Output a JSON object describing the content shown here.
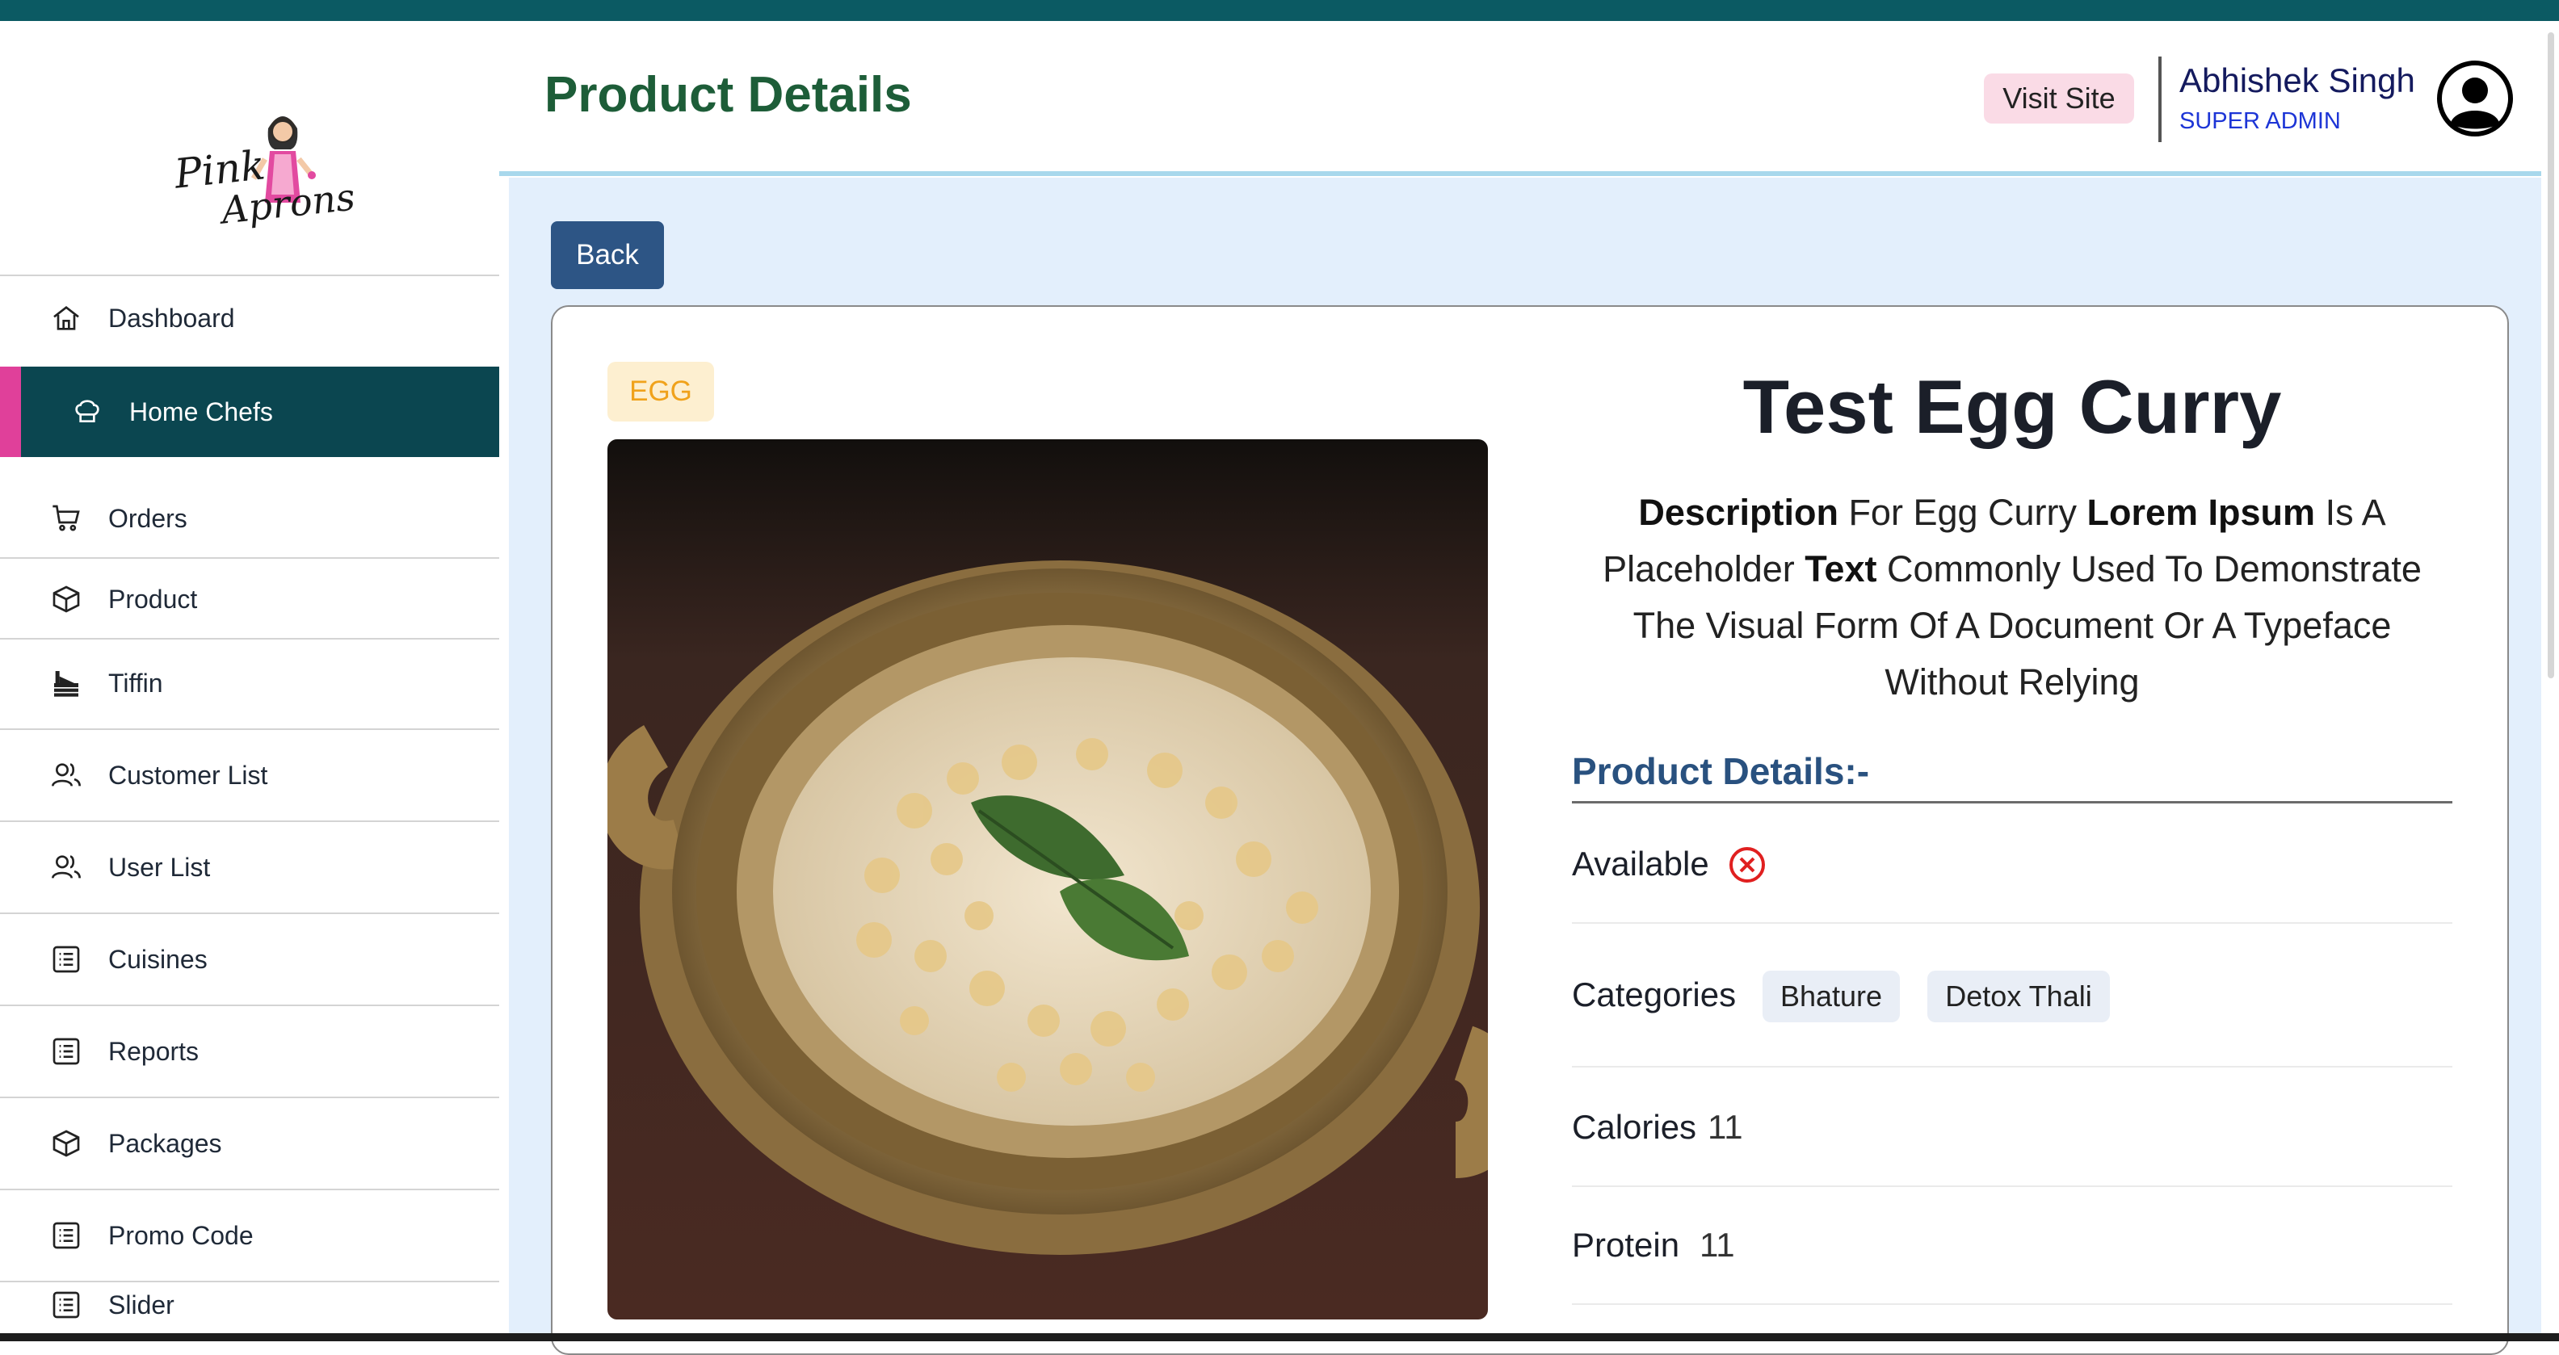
{
  "header": {
    "page_title": "Product Details",
    "visit_site_label": "Visit Site",
    "user_name": "Abhishek Singh",
    "user_role": "SUPER ADMIN"
  },
  "logo": {
    "line1": "Pink",
    "line2": "Aprons"
  },
  "sidebar": {
    "items": [
      {
        "label": "Dashboard",
        "icon": "home-icon"
      },
      {
        "label": "Home Chefs",
        "icon": "chef-hat-icon",
        "active": true
      },
      {
        "label": "Orders",
        "icon": "cart-icon"
      },
      {
        "label": "Product",
        "icon": "box-icon"
      },
      {
        "label": "Tiffin",
        "icon": "tiffin-icon"
      },
      {
        "label": "Customer List",
        "icon": "users-icon"
      },
      {
        "label": "User List",
        "icon": "users-icon"
      },
      {
        "label": "Cuisines",
        "icon": "list-icon"
      },
      {
        "label": "Reports",
        "icon": "list-icon"
      },
      {
        "label": "Packages",
        "icon": "box-icon"
      },
      {
        "label": "Promo Code",
        "icon": "list-icon"
      },
      {
        "label": "Slider",
        "icon": "list-icon"
      }
    ]
  },
  "main": {
    "back_label": "Back",
    "badge": "EGG",
    "product": {
      "title": "Test Egg Curry",
      "description_parts": [
        "Description",
        " For Egg Curry ",
        "Lorem Ipsum",
        " Is A Placeholder ",
        "Text",
        " Commonly Used To Demonstrate The Visual Form Of A Document Or A Typeface Without Relying"
      ],
      "section_title": "Product Details:-",
      "available_label": "Available",
      "available": false,
      "categories_label": "Categories",
      "categories": [
        "Bhature",
        "Detox Thali"
      ],
      "calories_label": "Calories",
      "calories_value": "11",
      "protein_label": "Protein",
      "protein_value": "11"
    }
  },
  "colors": {
    "topbar": "#0b5a63",
    "sidebar_active": "#0b4650",
    "active_accent": "#e0409a",
    "title_green": "#1d5d38",
    "back_button": "#2d5585",
    "section_title": "#29517f",
    "content_bg": "#e3effc"
  }
}
